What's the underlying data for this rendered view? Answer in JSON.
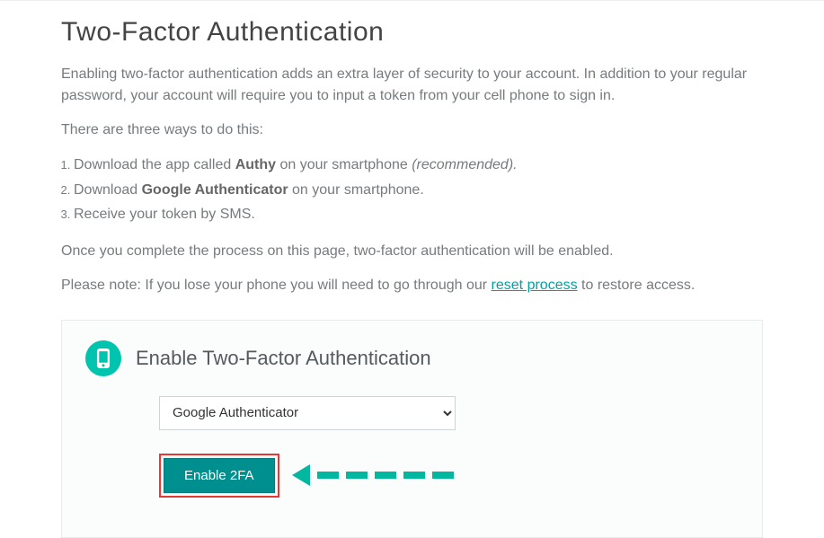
{
  "page": {
    "title": "Two-Factor Authentication",
    "intro": "Enabling two-factor authentication adds an extra layer of security to your account. In addition to your regular password, your account will require you to input a token from your cell phone to sign in.",
    "ways_intro": "There are three ways to do this:",
    "list": {
      "item1_pre": "Download the app called ",
      "item1_bold": "Authy",
      "item1_post": " on your smartphone ",
      "item1_rec": "(recommended).",
      "item2_pre": "Download ",
      "item2_bold": "Google Authenticator",
      "item2_post": " on your smartphone.",
      "item3": "Receive your token by SMS."
    },
    "complete_note": "Once you complete the process on this page, two-factor authentication will be enabled.",
    "please_note_pre": "Please note: If you lose your phone you will need to go through our ",
    "please_note_link": "reset process",
    "please_note_post": " to restore access."
  },
  "card": {
    "title": "Enable Two-Factor Authentication",
    "select_value": "Google Authenticator",
    "button_label": "Enable 2FA"
  }
}
